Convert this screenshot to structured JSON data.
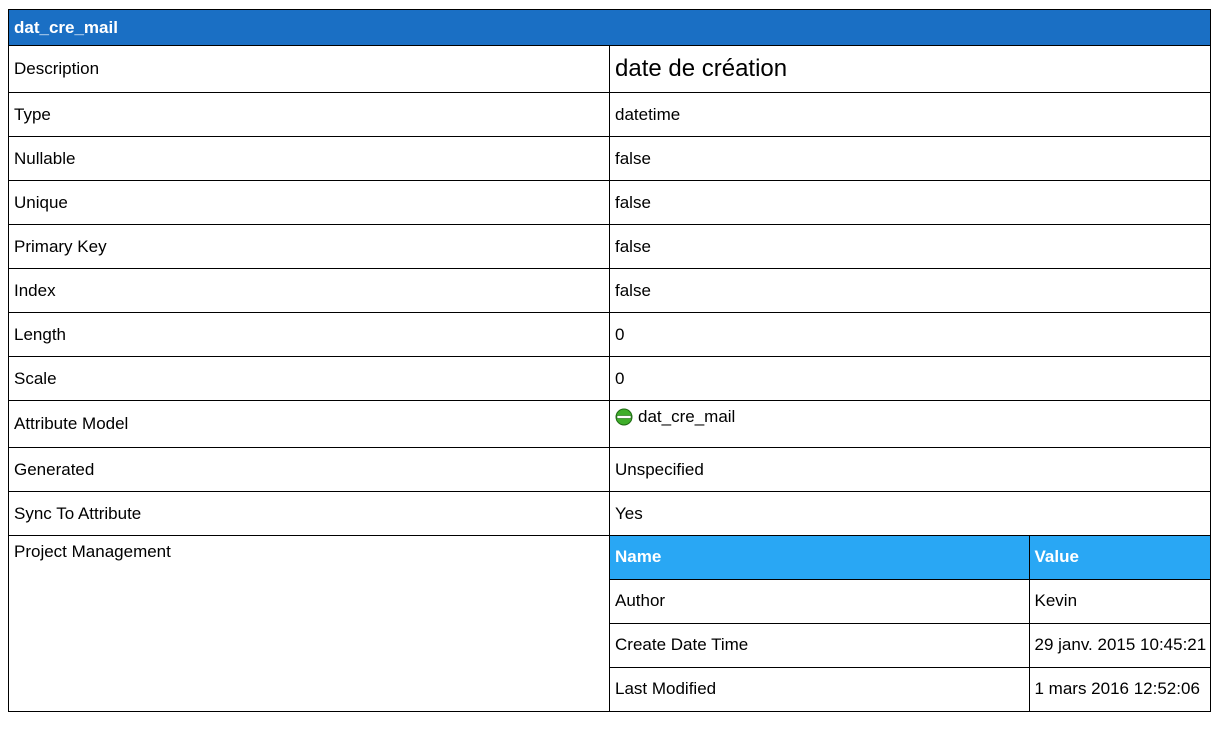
{
  "header": {
    "title": "dat_cre_mail"
  },
  "properties": [
    {
      "label": "Description",
      "value": "date de création"
    },
    {
      "label": "Type",
      "value": "datetime"
    },
    {
      "label": "Nullable",
      "value": "false"
    },
    {
      "label": "Unique",
      "value": "false"
    },
    {
      "label": "Primary Key",
      "value": "false"
    },
    {
      "label": "Index",
      "value": "false"
    },
    {
      "label": "Length",
      "value": "0"
    },
    {
      "label": "Scale",
      "value": "0"
    },
    {
      "label": "Attribute Model",
      "value": "dat_cre_mail",
      "icon": "attribute-icon"
    },
    {
      "label": "Generated",
      "value": "Unspecified"
    },
    {
      "label": "Sync To Attribute",
      "value": "Yes"
    }
  ],
  "project_management": {
    "label": "Project Management",
    "columns": [
      "Name",
      "Value"
    ],
    "rows": [
      [
        "Author",
        "Kevin"
      ],
      [
        "Create Date Time",
        "29 janv. 2015 10:45:21"
      ],
      [
        "Last Modified",
        "1 mars 2016 12:52:06"
      ]
    ]
  },
  "colors": {
    "header_bg": "#1a6fc4",
    "subheader_bg": "#29a7f4",
    "icon_green": "#3fae2a"
  }
}
